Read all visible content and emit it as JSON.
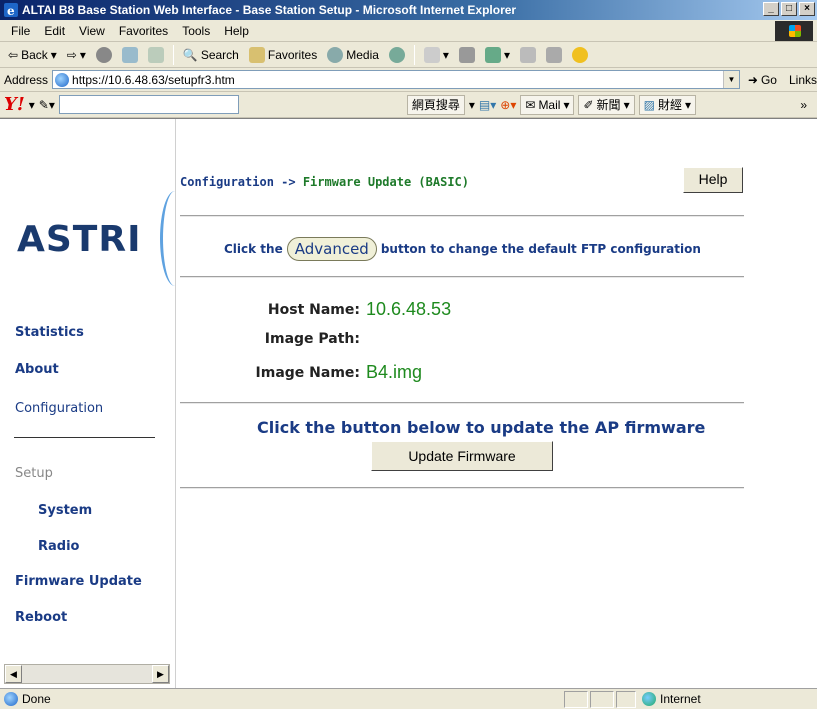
{
  "window": {
    "title": "ALTAI B8 Base Station Web Interface - Base Station Setup - Microsoft Internet Explorer",
    "minimize": "_",
    "maximize": "□",
    "close": "×"
  },
  "menu": [
    "File",
    "Edit",
    "View",
    "Favorites",
    "Tools",
    "Help"
  ],
  "toolbar": {
    "back": "Back",
    "search": "Search",
    "favorites": "Favorites",
    "media": "Media"
  },
  "address": {
    "label": "Address",
    "url": "https://10.6.48.63/setupfr3.htm",
    "go": "Go",
    "links": "Links"
  },
  "yahoo": {
    "logo": "Y!",
    "search_btn": "網頁搜尋",
    "mail": "Mail",
    "news": "新聞",
    "finance": "財經"
  },
  "sidebar": {
    "logo": "ASTRI",
    "items": [
      {
        "label": "Statistics"
      },
      {
        "label": "About"
      },
      {
        "label": "Configuration"
      },
      {
        "label": "Setup"
      },
      {
        "label": "System"
      },
      {
        "label": "Radio"
      },
      {
        "label": "Firmware Update"
      },
      {
        "label": "Reboot"
      }
    ]
  },
  "main": {
    "breadcrumb_parent": "Configuration",
    "breadcrumb_sep": " -> ",
    "breadcrumb_current": "Firmware Update (BASIC)",
    "help": "Help",
    "advanced_prefix": "Click the",
    "advanced_button": "Advanced",
    "advanced_suffix": "button to change the default FTP configuration",
    "host_label": "Host Name:",
    "host_value": "10.6.48.53",
    "path_label": "Image Path:",
    "path_value": "",
    "image_label": "Image Name:",
    "image_value": "B4.img",
    "update_message": "Click the button below to update the AP firmware",
    "update_button": "Update Firmware"
  },
  "status": {
    "text": "Done",
    "zone": "Internet"
  }
}
